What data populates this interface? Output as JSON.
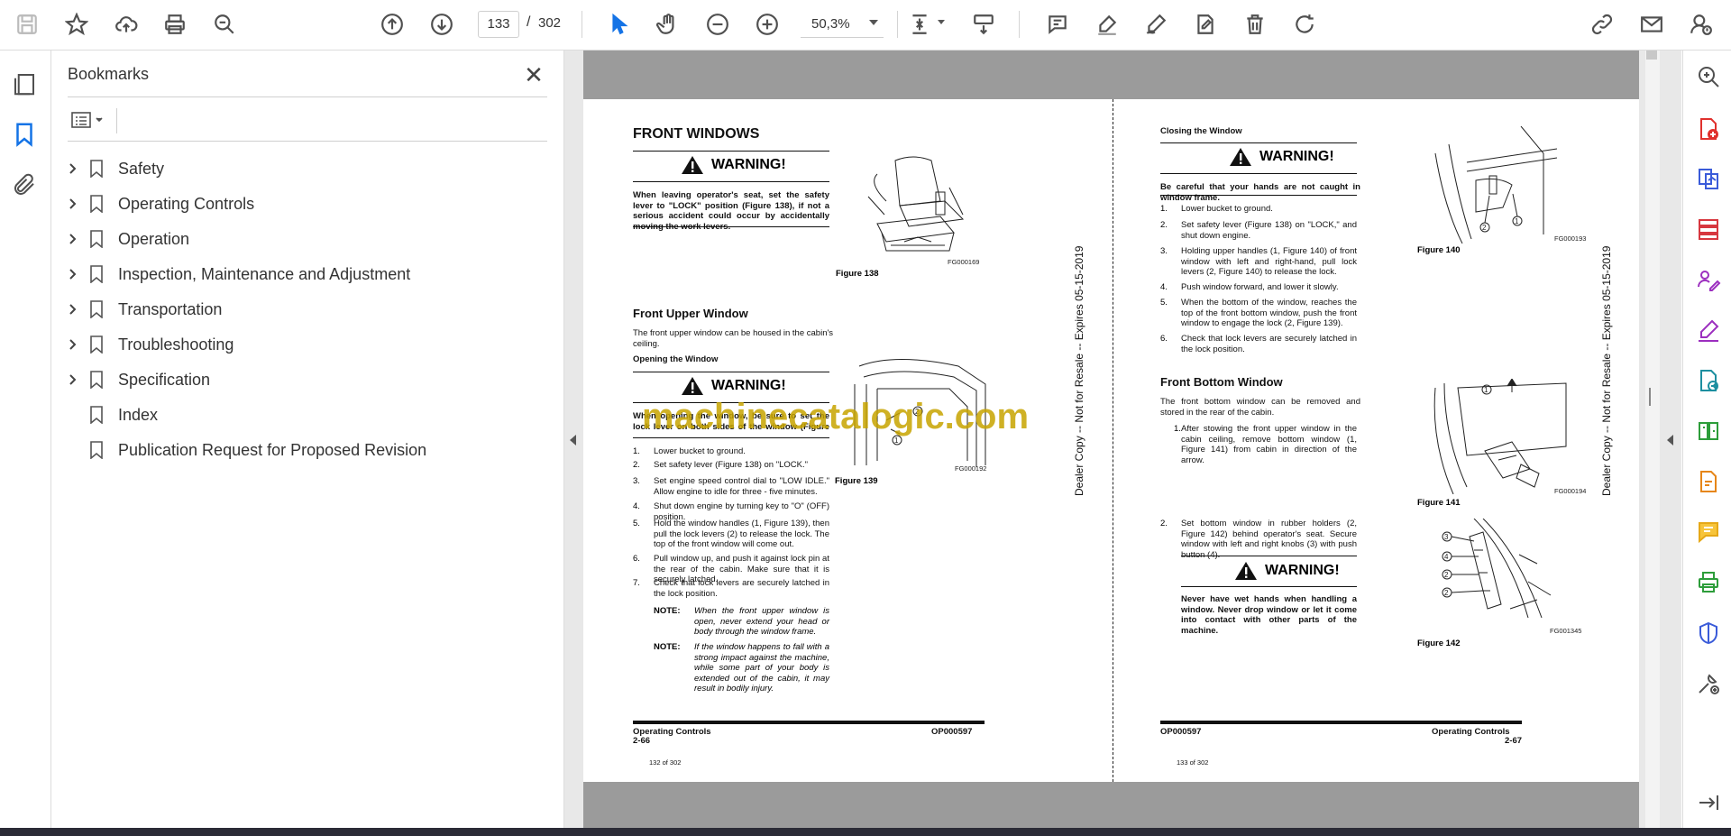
{
  "toolbar": {
    "current_page": "133",
    "page_separator": "/",
    "total_pages": "302",
    "zoom": "50,3%"
  },
  "bookmarks": {
    "title": "Bookmarks",
    "close_glyph": "✕",
    "items": [
      {
        "label": "Safety",
        "expandable": true
      },
      {
        "label": "Operating Controls",
        "expandable": true
      },
      {
        "label": "Operation",
        "expandable": true
      },
      {
        "label": "Inspection, Maintenance and Adjustment",
        "expandable": true
      },
      {
        "label": "Transportation",
        "expandable": true
      },
      {
        "label": "Troubleshooting",
        "expandable": true
      },
      {
        "label": "Specification",
        "expandable": true
      },
      {
        "label": "Index",
        "expandable": false
      },
      {
        "label": "Publication Request for Proposed Revision",
        "expandable": false
      }
    ]
  },
  "watermark": "machinecatalogic.com",
  "left_page": {
    "heading": "FRONT WINDOWS",
    "warning1_title": "WARNING!",
    "warning1_text": "When leaving operator's seat, set the safety lever to \"LOCK\" position (Figure 138), if not a serious accident could occur by accidentally moving the work levers.",
    "fig138_label": "Figure 138",
    "fig138_code": "FG000169",
    "section": "Front Upper Window",
    "section_text": "The front upper window can be housed in the cabin's ceiling.",
    "subsection": "Opening the Window",
    "warning2_title": "WARNING!",
    "warning2_text": "When opening the window, be sure to set the lock lever on both sides of the window (Figure 139) to prevent",
    "fig139_label": "Figure 139",
    "fig139_code": "FG000192",
    "steps": [
      {
        "n": "1.",
        "t": "Lower bucket to ground."
      },
      {
        "n": "2.",
        "t": "Set safety lever (Figure 138) on \"LOCK.\""
      },
      {
        "n": "3.",
        "t": "Set engine speed control dial to \"LOW IDLE.\" Allow engine to idle for three - five minutes."
      },
      {
        "n": "4.",
        "t": "Shut down engine by turning key to \"O\" (OFF) position."
      },
      {
        "n": "5.",
        "t": "Hold the window handles (1, Figure 139), then pull the lock levers (2) to release the lock. The top of the front window will come out."
      },
      {
        "n": "6.",
        "t": "Pull window up, and push it against lock pin at the rear of the cabin. Make sure that it is securely latched."
      },
      {
        "n": "7.",
        "t": "Check that lock levers are securely latched in the lock position."
      }
    ],
    "note_label": "NOTE:",
    "note1": "When the front upper window is open, never extend your head or body through the window frame.",
    "note2": "If the window happens to fall with a strong impact against the machine, while some part of your body is extended out of the cabin, it may result in bodily injury.",
    "footer_left": "Operating Controls",
    "footer_left_page": "2-66",
    "footer_right": "OP000597",
    "page_counter": "132 of 302",
    "side_stamp": "Dealer Copy -- Not for Resale -- Expires 05-15-2019"
  },
  "right_page": {
    "subsection": "Closing the Window",
    "warning1_title": "WARNING!",
    "warning1_text": "Be careful that your hands are not caught in window frame.",
    "steps": [
      {
        "n": "1.",
        "t": "Lower bucket to ground."
      },
      {
        "n": "2.",
        "t": "Set safety lever (Figure 138) on \"LOCK,\" and shut down engine."
      },
      {
        "n": "3.",
        "t": "Holding upper handles (1, Figure 140) of front window with left and right-hand, pull lock levers (2, Figure 140) to release the lock."
      },
      {
        "n": "4.",
        "t": "Push window forward, and lower it slowly."
      },
      {
        "n": "5.",
        "t": "When the bottom of the window, reaches the top of the front bottom window, push the front window to engage the lock (2, Figure 139)."
      },
      {
        "n": "6.",
        "t": "Check that lock levers are securely latched in the lock position."
      }
    ],
    "fig140_label": "Figure 140",
    "fig140_code": "FG000193",
    "section": "Front Bottom Window",
    "section_text": "The front bottom window can be removed and stored in the rear of the cabin.",
    "steps2": [
      {
        "n": "1.",
        "t": "After stowing the front upper window in the cabin ceiling, remove bottom window (1, Figure 141) from cabin in direction of the arrow."
      },
      {
        "n": "2.",
        "t": "Set bottom window in rubber holders (2, Figure 142) behind operator's seat. Secure window with left and right knobs (3) with push button (4)."
      }
    ],
    "fig141_label": "Figure 141",
    "fig141_code": "FG000194",
    "warning2_title": "WARNING!",
    "warning2_text": "Never have wet hands when handling a window. Never drop window or let it come into contact with other parts of the machine.",
    "fig142_label": "Figure 142",
    "fig142_code": "FG001345",
    "footer_left": "OP000597",
    "footer_right": "Operating Controls",
    "footer_right_page": "2-67",
    "page_counter": "133 of 302",
    "side_stamp": "Dealer Copy -- Not for Resale -- Expires 05-15-2019"
  }
}
